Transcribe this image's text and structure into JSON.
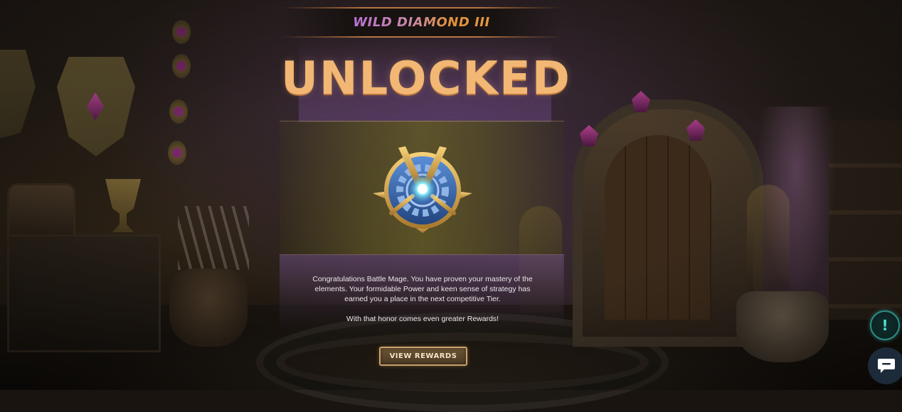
{
  "tier": {
    "title": "WILD DIAMOND III"
  },
  "headline": "UNLOCKED",
  "badge": {
    "icon": "diamond-tier-badge-icon"
  },
  "message": {
    "paragraph1": "Congratulations Battle Mage. You have proven your mastery of the elements. Your formidable Power and keen sense of strategy has earned you a place in the next competitive Tier.",
    "paragraph2": "With that honor comes even greater Rewards!"
  },
  "actions": {
    "view_rewards": "VIEW REWARDS"
  },
  "floating": {
    "alert_glyph": "!",
    "alert_icon": "alert-icon",
    "chat_icon": "chat-icon"
  },
  "colors": {
    "headline": "#f2b774",
    "tier_gradient_start": "#b872d8",
    "tier_gradient_end": "#e39a3c",
    "button_border": "#c9a16b",
    "alert_accent": "#2b8e87"
  }
}
